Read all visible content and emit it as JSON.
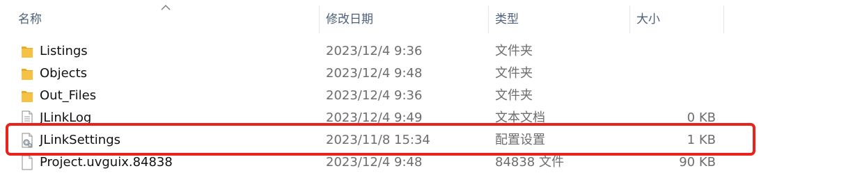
{
  "columns": {
    "name": "名称",
    "date": "修改日期",
    "type": "类型",
    "size": "大小"
  },
  "sort": {
    "column": "name",
    "icon": "chevron-up-icon"
  },
  "files": [
    {
      "name": "Listings",
      "date": "2023/12/4 9:36",
      "type": "文件夹",
      "size": "",
      "icon": "folder-icon"
    },
    {
      "name": "Objects",
      "date": "2023/12/4 9:48",
      "type": "文件夹",
      "size": "",
      "icon": "folder-icon"
    },
    {
      "name": "Out_Files",
      "date": "2023/12/4 9:36",
      "type": "文件夹",
      "size": "",
      "icon": "folder-icon"
    },
    {
      "name": "JLinkLog",
      "date": "2023/12/4 9:49",
      "type": "文本文档",
      "size": "0 KB",
      "icon": "text-file-icon"
    },
    {
      "name": "JLinkSettings",
      "date": "2023/11/8 15:34",
      "type": "配置设置",
      "size": "1 KB",
      "icon": "settings-file-icon",
      "highlighted": true
    },
    {
      "name": "Project.uvguix.84838",
      "date": "2023/12/4 9:48",
      "type": "84838 文件",
      "size": "90 KB",
      "icon": "file-icon"
    }
  ],
  "colors": {
    "highlight": "#e8231b",
    "folder": "#f5c244",
    "header_text": "#4c607a"
  }
}
